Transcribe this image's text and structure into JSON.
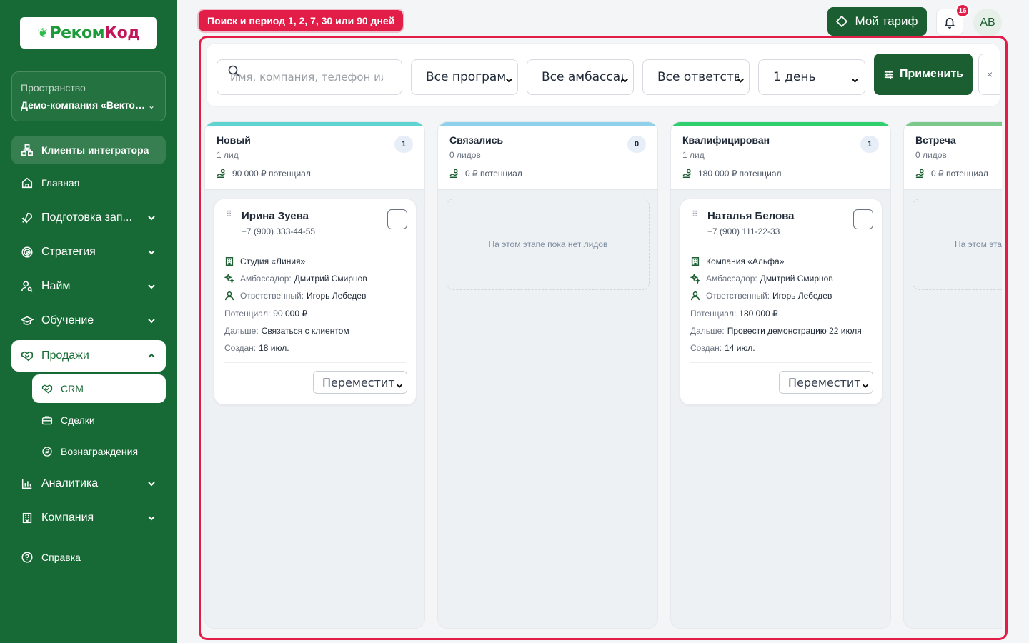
{
  "brand": {
    "logo_text_main": "Реком",
    "logo_text_accent": "Код"
  },
  "workspace": {
    "label": "Пространство",
    "value": "Демо-компания «Вектор»"
  },
  "sidebar": {
    "integrator": "Клиенты интегратора",
    "items": [
      {
        "label": "Главная"
      },
      {
        "label": "Подготовка зап..."
      },
      {
        "label": "Стратегия"
      },
      {
        "label": "Найм"
      },
      {
        "label": "Обучение"
      },
      {
        "label": "Продажи"
      },
      {
        "label": "Аналитика"
      },
      {
        "label": "Компания"
      },
      {
        "label": "Справка"
      }
    ],
    "sales_sub": [
      {
        "label": "CRM"
      },
      {
        "label": "Сделки"
      },
      {
        "label": "Вознаграждения"
      }
    ]
  },
  "topbar": {
    "hint": "Поиск и период 1, 2, 7, 30 или 90 дней",
    "tariff": "Мой тариф",
    "notifications": "16",
    "avatar": "АВ"
  },
  "filters": {
    "search_placeholder": "Имя, компания, телефон или",
    "programs": "Все программы",
    "ambassadors": "Все амбассадоры",
    "responsible": "Все ответственные",
    "period": "1 день",
    "apply": "Применить",
    "clear": "×"
  },
  "columns": [
    {
      "title": "Новый",
      "badge": "1",
      "count_text": "1 лид",
      "potential": "90 000 ₽ потенциал",
      "color": "#5ed3d0"
    },
    {
      "title": "Связались",
      "badge": "0",
      "count_text": "0 лидов",
      "potential": "0 ₽ потенциал",
      "color": "#8fd0ea",
      "empty": "На этом этапе пока нет лидов"
    },
    {
      "title": "Квалифицирован",
      "badge": "1",
      "count_text": "1 лид",
      "potential": "180 000 ₽ потенциал",
      "color": "#2fcf6e"
    },
    {
      "title": "Встреча",
      "badge": "",
      "count_text": "0 лидов",
      "potential": "0 ₽ потенциал",
      "color": "#7bc98a",
      "empty": "На этом эта"
    }
  ],
  "cards": [
    {
      "name": "Ирина Зуева",
      "phone": "+7 (900) 333-44-55",
      "company": "Студия «Линия»",
      "ambassador_label": "Амбассадор:",
      "ambassador": "Дмитрий Смирнов",
      "responsible_label": "Ответственный:",
      "responsible": "Игорь Лебедев",
      "potential_label": "Потенциал:",
      "potential": "90 000 ₽",
      "next_label": "Дальше:",
      "next": "Связаться с клиентом",
      "created_label": "Создан:",
      "created": "18 июл.",
      "move": "Переместить..."
    },
    {
      "name": "Наталья Белова",
      "phone": "+7 (900) 111-22-33",
      "company": "Компания «Альфа»",
      "ambassador_label": "Амбассадор:",
      "ambassador": "Дмитрий Смирнов",
      "responsible_label": "Ответственный:",
      "responsible": "Игорь Лебедев",
      "potential_label": "Потенциал:",
      "potential": "180 000 ₽",
      "next_label": "Дальше:",
      "next": "Провести демонстрацию 22 июля",
      "created_label": "Создан:",
      "created": "14 июл.",
      "move": "Переместить..."
    }
  ]
}
